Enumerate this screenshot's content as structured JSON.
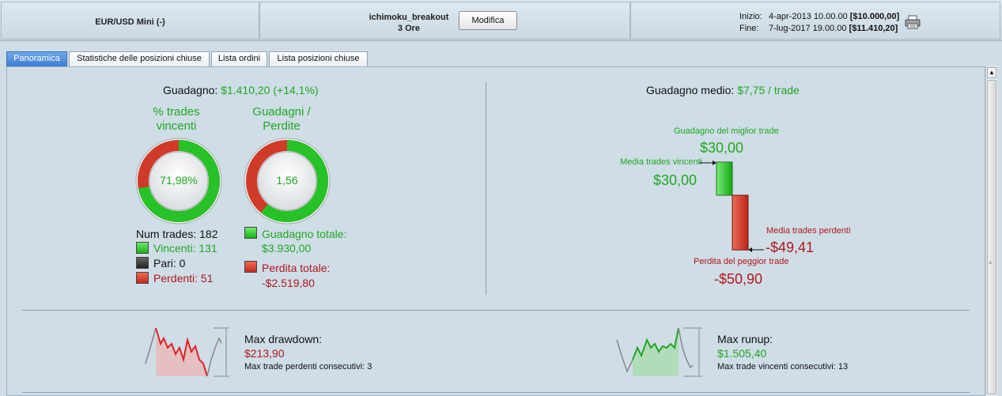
{
  "header": {
    "symbol": "EUR/USD Mini (-)",
    "strategy": "ichimoku_breakout",
    "timeframe": "3 Ore",
    "modify_label": "Modifica",
    "start_label": "Inizio:",
    "start_date": "4-apr-2013 10.00.00",
    "start_value": "[$10.000,00]",
    "end_label": "Fine:",
    "end_date": "7-lug-2017 19.00.00",
    "end_value": "[$11.410,20]",
    "print_icon": "printer-icon"
  },
  "tabs": [
    {
      "label": "Panoramica",
      "active": true
    },
    {
      "label": "Statistiche delle posizioni chiuse",
      "active": false
    },
    {
      "label": "Lista ordini",
      "active": false
    },
    {
      "label": "Lista posizioni chiuse",
      "active": false
    }
  ],
  "overview": {
    "gain_label": "Guadagno:",
    "gain_value": "$1.410,20 (+14,1%)",
    "win_ring": {
      "title_line1": "% trades",
      "title_line2": "vincenti",
      "value_text": "71,98%",
      "fraction": 0.7198
    },
    "ratio_ring": {
      "title_line1": "Guadagni /",
      "title_line2": "Perdite",
      "value_text": "1,56",
      "fraction": 0.6093
    },
    "num_trades_label": "Num trades: 182",
    "winners": "Vincenti: 131",
    "even": "Pari: 0",
    "losers": "Perdenti: 51",
    "total_gain_label": "Guadagno totale:",
    "total_gain_value": "$3.930,00",
    "total_loss_label": "Perdita totale:",
    "total_loss_value": "-$2.519,80"
  },
  "average": {
    "label": "Guadagno medio:",
    "value": "$7,75 / trade",
    "best_label": "Guadagno del miglior trade",
    "best_value": "$30,00",
    "avg_win_label": "Media trades vincenti",
    "avg_win_value": "$30,00",
    "avg_loss_label": "Media trades perdenti",
    "avg_loss_value": "-$49,41",
    "worst_label": "Perdita del peggior trade",
    "worst_value": "-$50,90",
    "chart_data": {
      "type": "bar",
      "categories": [
        "Media trades vincenti",
        "Media trades perdenti"
      ],
      "values": [
        30.0,
        -49.41
      ]
    }
  },
  "drawdown": {
    "label": "Max drawdown:",
    "value": "$213,90",
    "consec_label": "Max trade perdenti consecutivi: 3"
  },
  "runup": {
    "label": "Max runup:",
    "value": "$1.505,40",
    "consec_label": "Max trade vincenti consecutivi: 13"
  },
  "colors": {
    "win": "#1fa81f",
    "loss": "#b01818",
    "tab_active": "#3c7ed3"
  }
}
